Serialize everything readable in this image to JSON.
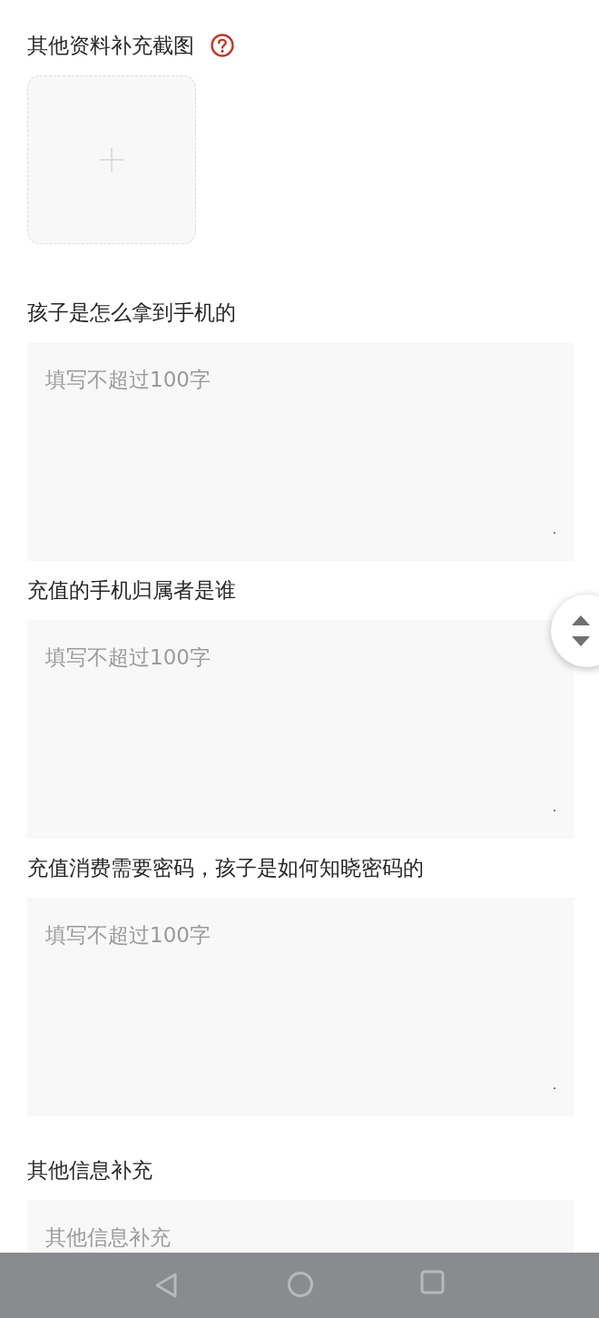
{
  "fields": [
    {
      "kind": "upload",
      "label": "其他资料补充截图",
      "help": true
    },
    {
      "kind": "textarea",
      "label": "孩子是怎么拿到手机的",
      "placeholder": "填写不超过100字"
    },
    {
      "kind": "textarea",
      "label": "充值的手机归属者是谁",
      "placeholder": "填写不超过100字"
    },
    {
      "kind": "textarea",
      "label": "充值消费需要密码，孩子是如何知晓密码的",
      "placeholder": "填写不超过100字"
    },
    {
      "kind": "textarea_cut",
      "label": "其他信息补充",
      "placeholder": "其他信息补充"
    }
  ]
}
